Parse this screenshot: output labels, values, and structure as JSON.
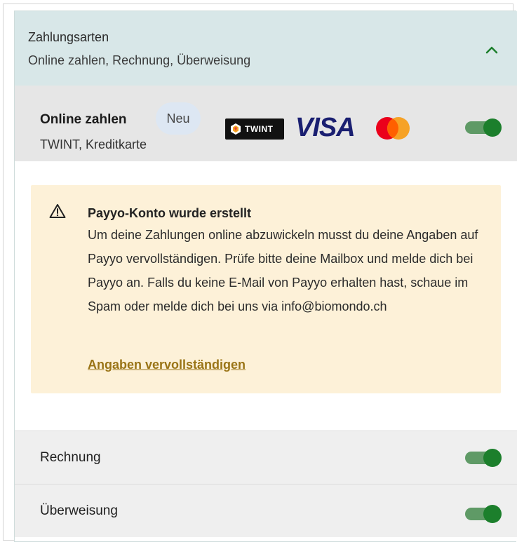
{
  "section": {
    "title": "Zahlungsarten",
    "subtitle": "Online zahlen, Rechnung, Überweisung",
    "expanded": true
  },
  "online": {
    "title": "Online zahlen",
    "badge": "Neu",
    "subtitle": "TWINT, Kreditkarte",
    "brands": {
      "twint": "TWINT",
      "visa": "VISA",
      "mastercard_icon": "mastercard-logo"
    },
    "enabled": true
  },
  "alert": {
    "icon": "warning-icon",
    "title": "Payyo-Konto wurde erstellt",
    "body": "Um deine Zahlungen online abzuwickeln musst du deine Angaben auf Payyo vervollständigen. Prüfe bitte deine Mailbox und melde dich bei Payyo an. Falls du keine E-Mail von Payyo erhalten hast, schaue im Spam oder melde dich bei uns via info@biomondo.ch",
    "link": "Angaben vervollständigen"
  },
  "methods": [
    {
      "label": "Rechnung",
      "enabled": true
    },
    {
      "label": "Überweisung",
      "enabled": true
    }
  ],
  "colors": {
    "header_bg": "#d8e7e8",
    "toggle_on": "#1c7f2c",
    "alert_bg": "#fdf1d8",
    "link": "#9a7416"
  }
}
